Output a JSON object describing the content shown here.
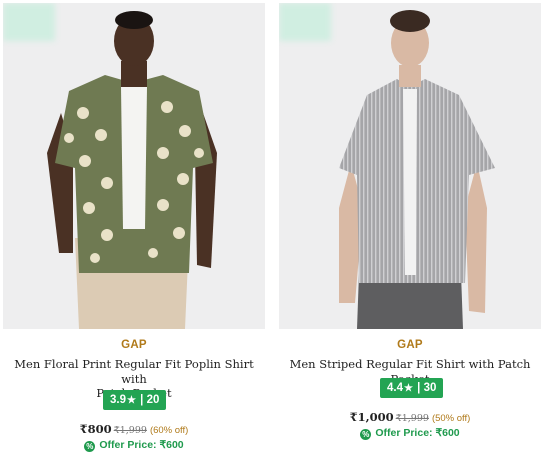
{
  "products": [
    {
      "brand": "GAP",
      "title_line1": "Men Floral Print Regular Fit Poplin Shirt with",
      "title_line2": "Patch Pocket",
      "rating": "3.9",
      "reviews": "20",
      "price": "₹800",
      "mrp": "₹1,999",
      "discount": "(60% off)",
      "offer": "Offer Price: ₹600"
    },
    {
      "brand": "GAP",
      "title_line1": "Men Striped Regular Fit Shirt with Patch Pocket",
      "title_line2": "",
      "rating": "4.4",
      "reviews": "30",
      "price": "₹1,000",
      "mrp": "₹1,999",
      "discount": "(50% off)",
      "offer": "Offer Price: ₹600"
    }
  ],
  "colors": {
    "brand": "#b07a1a",
    "rating_badge": "#23a453",
    "offer": "#1f9a4d"
  },
  "icons": {
    "rating": "star-icon",
    "offer": "offer-tag-icon"
  }
}
